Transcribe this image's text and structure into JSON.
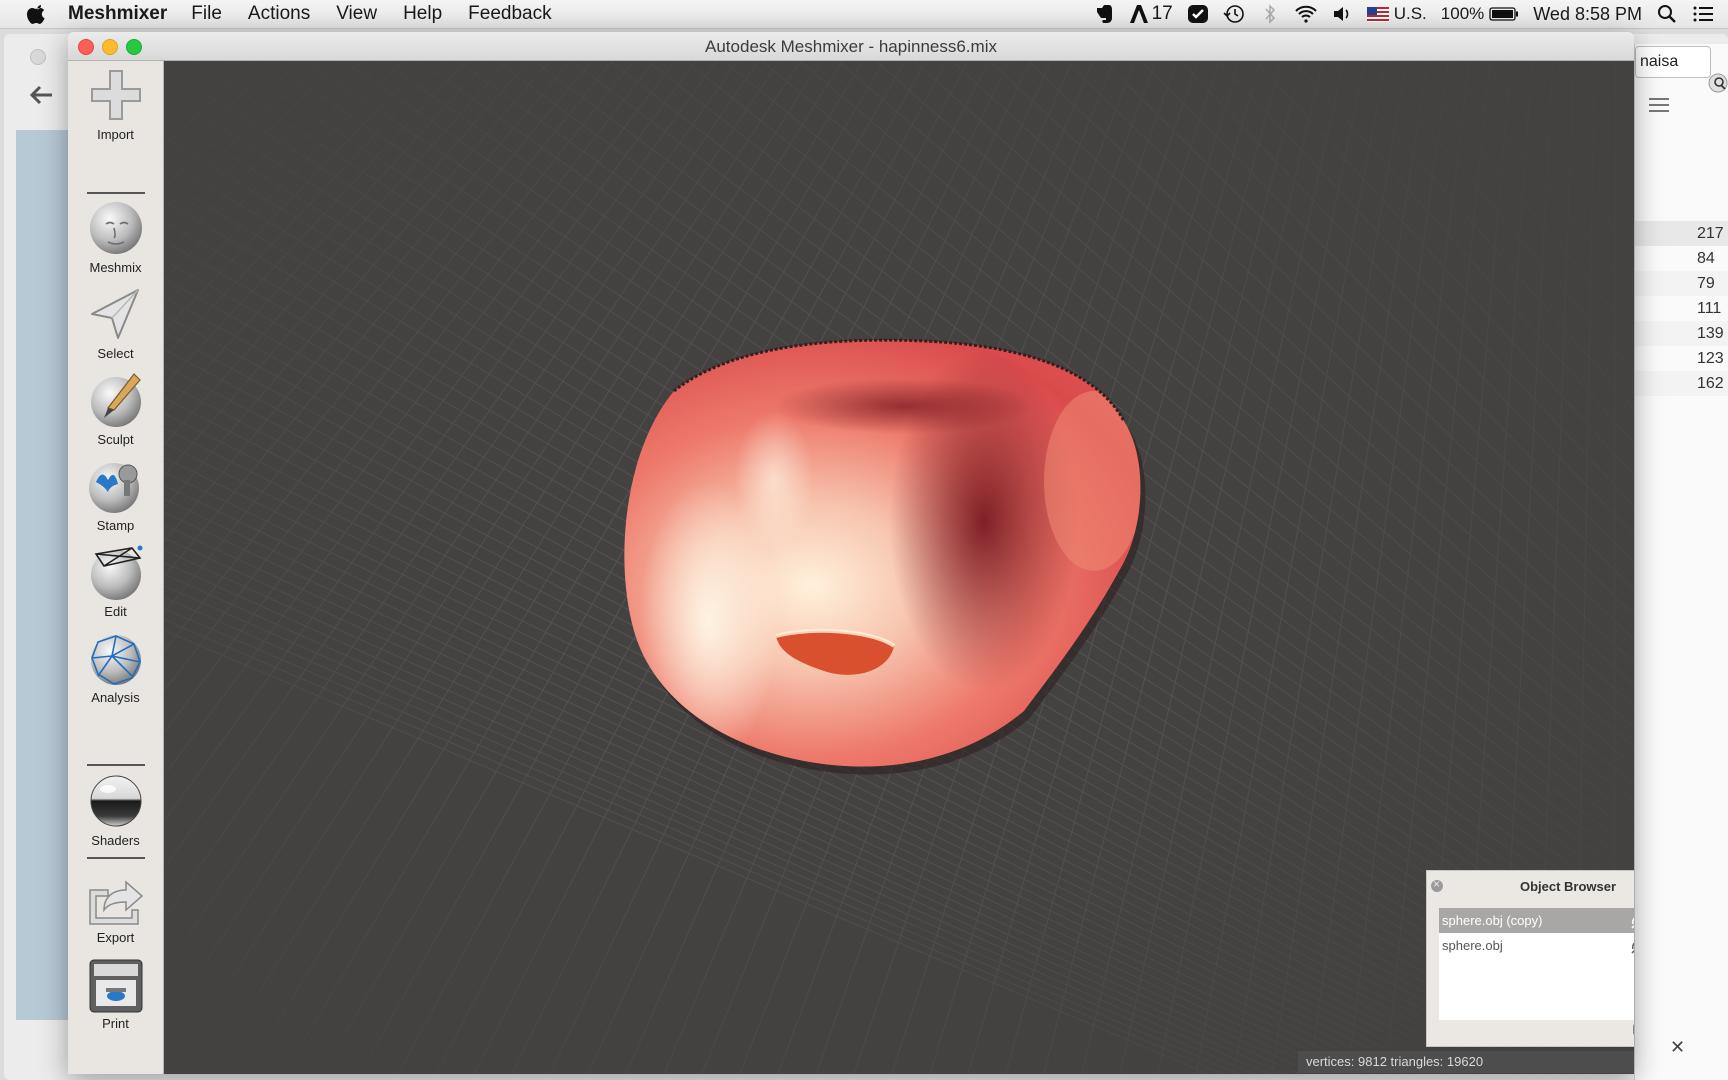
{
  "menubar": {
    "app_name": "Meshmixer",
    "menus": [
      "File",
      "Actions",
      "View",
      "Help",
      "Feedback"
    ],
    "status": {
      "badge_count": "17",
      "input_source": "U.S.",
      "battery": "100%",
      "clock": "Wed 8:58 PM"
    }
  },
  "window": {
    "title": "Autodesk Meshmixer - hapinness6.mix"
  },
  "tools": [
    {
      "label": "Import",
      "icon": "plus-icon"
    },
    {
      "label": "Meshmix",
      "icon": "face-sphere-icon"
    },
    {
      "label": "Select",
      "icon": "arrow-cursor-icon"
    },
    {
      "label": "Sculpt",
      "icon": "brush-sphere-icon"
    },
    {
      "label": "Stamp",
      "icon": "stamp-sphere-icon"
    },
    {
      "label": "Edit",
      "icon": "wireframe-box-sphere-icon"
    },
    {
      "label": "Analysis",
      "icon": "mesh-sphere-icon"
    },
    {
      "label": "Shaders",
      "icon": "chrome-sphere-icon"
    },
    {
      "label": "Export",
      "icon": "export-arrow-icon"
    },
    {
      "label": "Print",
      "icon": "printer-icon"
    }
  ],
  "object_browser": {
    "title": "Object Browser",
    "objects": [
      {
        "name": "sphere.obj (copy)",
        "selected": true
      },
      {
        "name": "sphere.obj",
        "selected": false
      }
    ]
  },
  "status_bar": {
    "text": "vertices: 9812 triangles: 19620"
  },
  "background_app": {
    "tab_label": "naisa",
    "column_values": [
      "217",
      "84",
      "79",
      "111",
      "139",
      "123",
      "162"
    ]
  },
  "colors": {
    "viewport_bg": "#434241",
    "mesh_base": "#e8605a",
    "mesh_highlight": "#fff1dc",
    "mesh_shadow": "#7a1a22",
    "selected_row": "#a8a7a6"
  }
}
